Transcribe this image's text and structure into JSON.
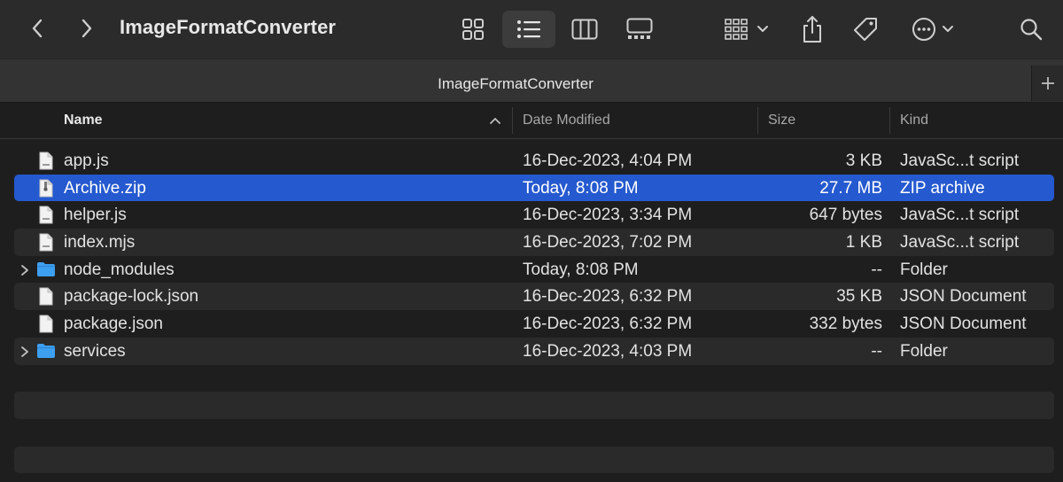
{
  "window": {
    "title": "ImageFormatConverter"
  },
  "tab": {
    "title": "ImageFormatConverter"
  },
  "columns": {
    "name": "Name",
    "date": "Date Modified",
    "size": "Size",
    "kind": "Kind"
  },
  "files": [
    {
      "name": "app.js",
      "date": "16-Dec-2023, 4:04 PM",
      "size": "3 KB",
      "kind": "JavaSc...t script",
      "icon": "document-icon"
    },
    {
      "name": "Archive.zip",
      "date": "Today, 8:08 PM",
      "size": "27.7 MB",
      "kind": "ZIP archive",
      "icon": "zip-icon"
    },
    {
      "name": "helper.js",
      "date": "16-Dec-2023, 3:34 PM",
      "size": "647 bytes",
      "kind": "JavaSc...t script",
      "icon": "document-icon"
    },
    {
      "name": "index.mjs",
      "date": "16-Dec-2023, 7:02 PM",
      "size": "1 KB",
      "kind": "JavaSc...t script",
      "icon": "document-icon"
    },
    {
      "name": "node_modules",
      "date": "Today, 8:08 PM",
      "size": "--",
      "kind": "Folder",
      "icon": "folder-icon"
    },
    {
      "name": "package-lock.json",
      "date": "16-Dec-2023, 6:32 PM",
      "size": "35 KB",
      "kind": "JSON Document",
      "icon": "document-icon"
    },
    {
      "name": "package.json",
      "date": "16-Dec-2023, 6:32 PM",
      "size": "332 bytes",
      "kind": "JSON Document",
      "icon": "document-icon"
    },
    {
      "name": "services",
      "date": "16-Dec-2023, 4:03 PM",
      "size": "--",
      "kind": "Folder",
      "icon": "folder-icon"
    }
  ],
  "colors": {
    "selection": "#2559cf",
    "folder": "#3d9ff0",
    "background": "#1e1e1e"
  }
}
